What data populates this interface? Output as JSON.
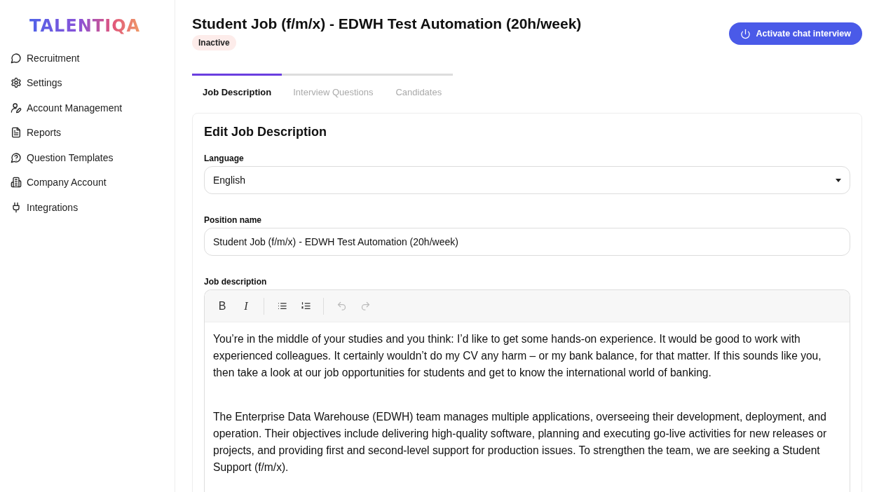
{
  "logo": "TALENTIQA",
  "sidebar": {
    "items": [
      {
        "label": "Recruitment"
      },
      {
        "label": "Settings"
      },
      {
        "label": "Account Management"
      },
      {
        "label": "Reports"
      },
      {
        "label": "Question Templates"
      },
      {
        "label": "Company Account"
      },
      {
        "label": "Integrations"
      }
    ]
  },
  "header": {
    "title": "Student Job (f/m/x) - EDWH Test Automation (20h/week)",
    "status": "Inactive",
    "action": "Activate chat interview"
  },
  "tabs": [
    {
      "label": "Job Description",
      "selected": true
    },
    {
      "label": "Interview Questions",
      "selected": false
    },
    {
      "label": "Candidates",
      "selected": false
    }
  ],
  "form": {
    "title": "Edit Job Description",
    "language": {
      "label": "Language",
      "value": "English"
    },
    "position": {
      "label": "Position name",
      "value": "Student Job (f/m/x) - EDWH Test Automation (20h/week)"
    },
    "description": {
      "label": "Job description",
      "toolbar": [
        {
          "kind": "bold",
          "text": "B",
          "disabled": false
        },
        {
          "kind": "italic",
          "text": "I",
          "disabled": false
        },
        {
          "kind": "divider"
        },
        {
          "kind": "bullets",
          "disabled": false
        },
        {
          "kind": "numbers",
          "disabled": false
        },
        {
          "kind": "divider"
        },
        {
          "kind": "undo",
          "disabled": true
        },
        {
          "kind": "redo",
          "disabled": true
        }
      ],
      "paragraphs": [
        "You’re in the middle of your studies and you think: I’d like to get some hands-on experience. It would be good to work with experienced colleagues. It certainly wouldn’t do my CV any harm – or my bank balance, for that matter. If this sounds like you, then take a look at our job opportunities for students and get to know the international world of banking.",
        "The Enterprise Data Warehouse (EDWH) team manages multiple applications, overseeing their development, deployment, and operation. Their objectives include delivering high-quality software, planning and executing go-live activities for new releases or projects, and providing first and second-level support for production issues. To strengthen the team, we are seeking a Student Support (f/m/x)."
      ]
    }
  }
}
